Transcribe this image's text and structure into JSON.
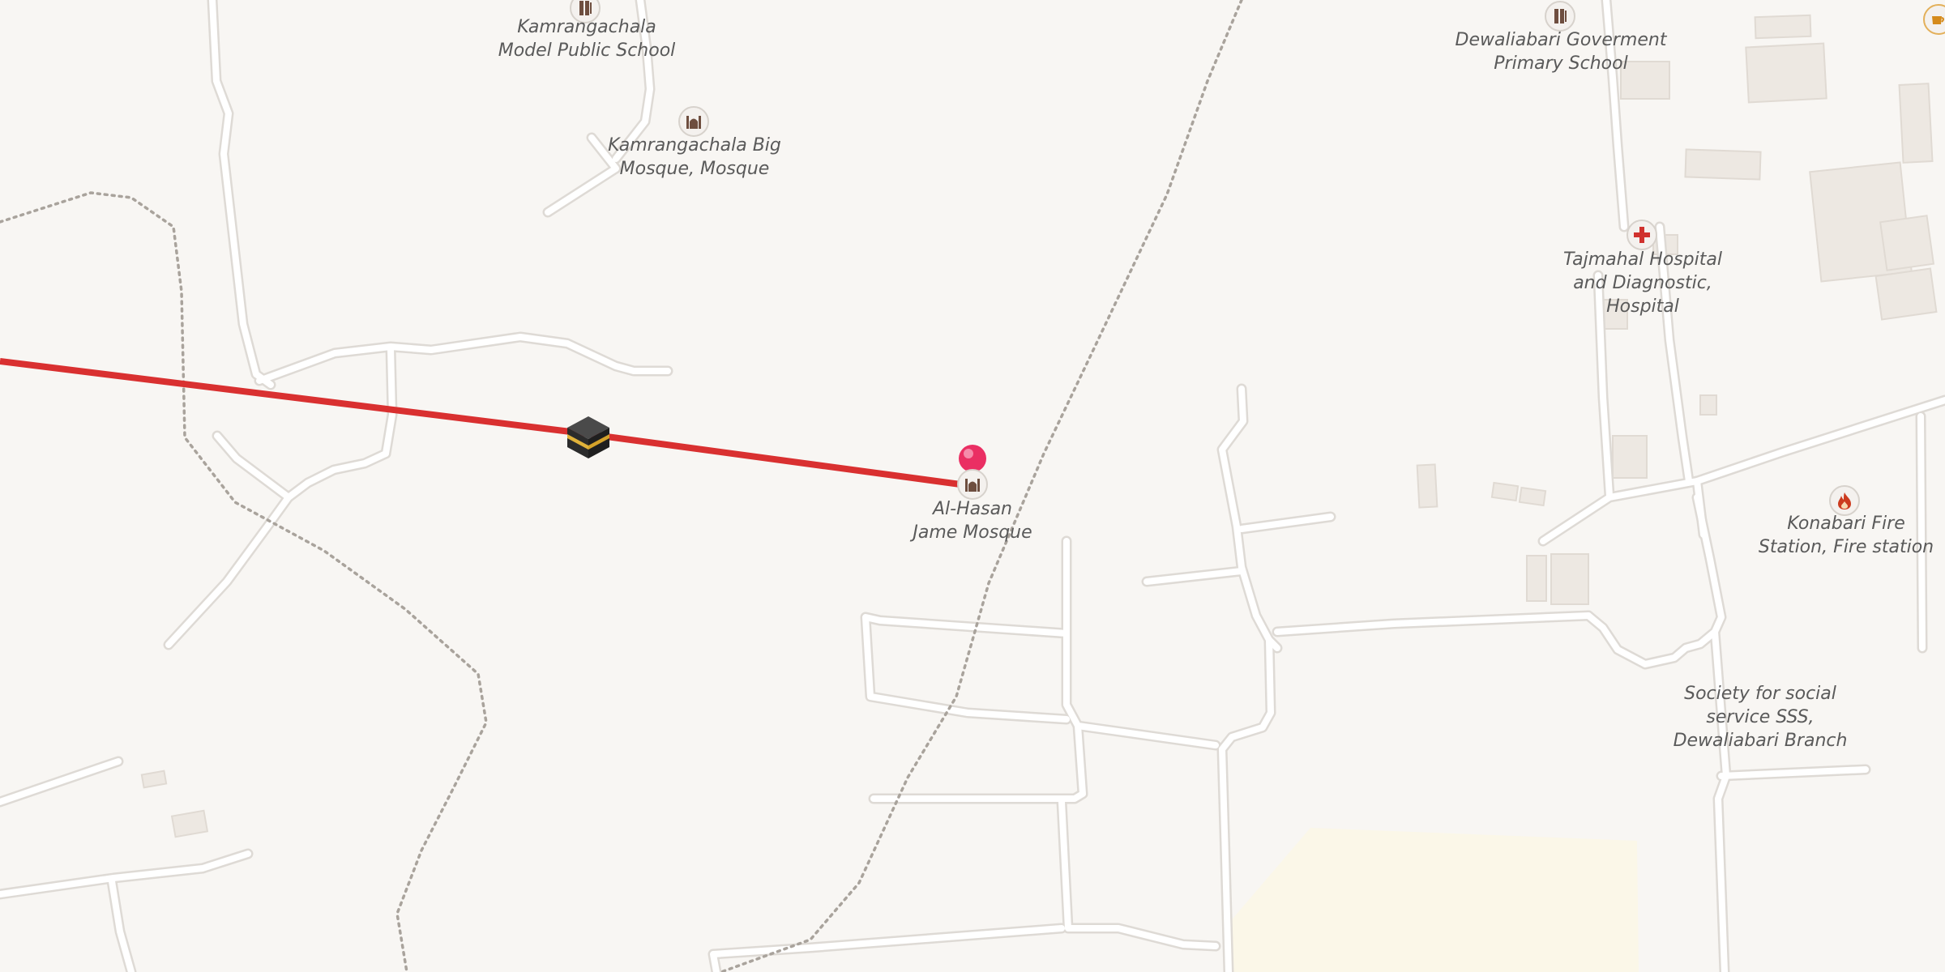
{
  "map": {
    "colors": {
      "background": "#f8f6f3",
      "road": "#ffffff",
      "road_casing": "#dedad5",
      "building": "#ede8e2",
      "route_line": "#d93030",
      "pin": "#ea2f63",
      "poi_icon": "#6e4e3f",
      "hospital_icon": "#d0312d",
      "fire_icon": "#cc3b1e"
    },
    "route": {
      "icon": "kaaba-icon",
      "destination_icon": "pin-icon"
    },
    "pois": [
      {
        "id": "school-north",
        "icon": "school-icon",
        "lines": [
          "Kamrangachala",
          "Model Public School"
        ]
      },
      {
        "id": "mosque-big",
        "icon": "mosque-icon",
        "lines": [
          "Kamrangachala Big",
          "Mosque, Mosque"
        ]
      },
      {
        "id": "mosque-alhasan",
        "icon": "mosque-icon",
        "lines": [
          "Al-Hasan",
          "Jame Mosque"
        ]
      },
      {
        "id": "school-dewaliabari",
        "icon": "school-icon",
        "lines": [
          "Dewaliabari Goverment",
          "Primary School"
        ]
      },
      {
        "id": "hospital",
        "icon": "hospital-icon",
        "lines": [
          "Tajmahal Hospital",
          "and Diagnostic,",
          "Hospital"
        ]
      },
      {
        "id": "fire-station",
        "icon": "fire-station-icon",
        "lines": [
          "Konabari Fire",
          "Station, Fire station"
        ]
      },
      {
        "id": "society",
        "icon": "",
        "lines": [
          "Society for social",
          "service SSS,",
          "Dewaliabari Branch"
        ]
      }
    ]
  }
}
